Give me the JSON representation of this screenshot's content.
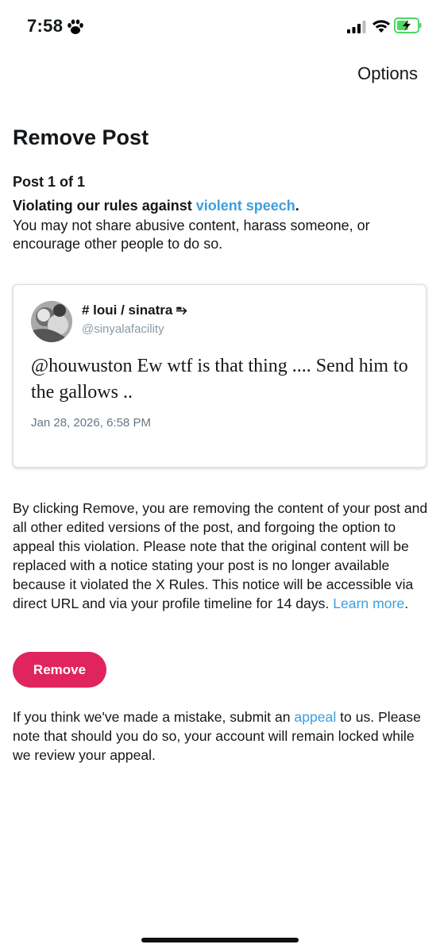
{
  "status_bar": {
    "time": "7:58",
    "icons": [
      "paw-icon",
      "signal-icon",
      "wifi-icon",
      "battery-charging-icon"
    ],
    "battery_color": "#4cd964"
  },
  "header": {
    "options_label": "Options"
  },
  "page": {
    "title": "Remove Post",
    "post_count": "Post 1 of 1",
    "violation_prefix": "Violating our rules against ",
    "violation_link": "violent speech",
    "violation_suffix": ".",
    "violation_description": "You may not share abusive content, harass someone, or encourage other people to do so."
  },
  "post": {
    "display_name": "# loui / sinatra",
    "name_glyph": "⥱",
    "handle": "@sinyalafacility",
    "text": "@houwuston Ew wtf is that thing .... Send him to the gallows ..",
    "date": "Jan 28, 2026, 6:58 PM"
  },
  "notice": {
    "text": "By clicking Remove, you are removing the content of your post and all other edited versions of the post, and forgoing the option to appeal this violation. Please note that the original content will be replaced with a notice stating your post is no longer available because it violated the X Rules. This notice will be accessible via direct URL and via your profile timeline for 14 days. ",
    "learn_more": "Learn more",
    "end": "."
  },
  "actions": {
    "remove_label": "Remove"
  },
  "appeal": {
    "prefix": "If you think we've made a mistake, submit an ",
    "link": "appeal",
    "suffix": " to us. Please note that should you do so, your account will remain locked while we review your appeal."
  },
  "colors": {
    "link": "#3c9ee0",
    "remove_button": "#e0245e",
    "handle": "#8899a6"
  }
}
